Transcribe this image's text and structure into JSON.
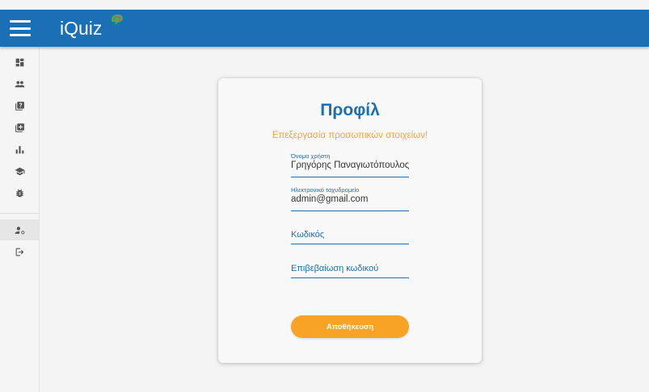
{
  "app": {
    "title": "iQuiz"
  },
  "sidebar": {
    "items": [
      {
        "icon": "dashboard-icon"
      },
      {
        "icon": "people-icon"
      },
      {
        "icon": "quiz-icon"
      },
      {
        "icon": "add-box-icon"
      },
      {
        "icon": "bar-chart-icon"
      },
      {
        "icon": "school-icon"
      },
      {
        "icon": "bug-icon"
      },
      {
        "icon": "manage-account-icon",
        "active": true
      },
      {
        "icon": "logout-icon"
      }
    ]
  },
  "profile": {
    "title": "Προφίλ",
    "subtitle": "Επεξεργασία προσωπικών στοιχείων!",
    "username": {
      "label": "Όνομα χρήστη",
      "value": "Γρηγόρης Παναγιωτόπουλος"
    },
    "email": {
      "label": "Ηλεκτρονικό ταχυδρομείο",
      "value": "admin@gmail.com"
    },
    "password": {
      "placeholder": "Κωδικός"
    },
    "confirm_password": {
      "placeholder": "Επιβεβαίωση κωδικού"
    },
    "save_label": "Αποθήκευση"
  },
  "colors": {
    "primary": "#1a6fb5",
    "accent": "#f9a326",
    "subtitle": "#f5a43a"
  }
}
